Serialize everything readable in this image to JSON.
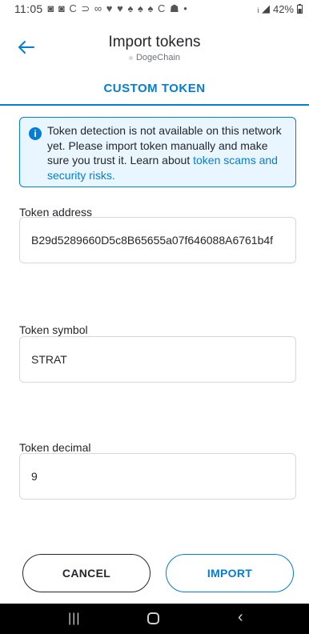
{
  "status_bar": {
    "time": "11:05",
    "icons": "◙ ◙ C ⊃ ∞ ♥ ♥ ♠ ♠ ♠ C ☗ •",
    "signal": "ᵢ ◢",
    "battery": "42%"
  },
  "header": {
    "title": "Import tokens",
    "network": "DogeChain"
  },
  "tab": {
    "label": "CUSTOM TOKEN"
  },
  "alert": {
    "icon": "i",
    "text": "Token detection is not available on this network yet. Please import token manually and make sure you trust it. Learn about ",
    "link": "token scams and security risks."
  },
  "form": {
    "address": {
      "label": "Token address",
      "value": "B29d5289660D5c8B65655a07f646088A6761b4f"
    },
    "symbol": {
      "label": "Token symbol",
      "value": "STRAT"
    },
    "decimal": {
      "label": "Token decimal",
      "value": "9"
    }
  },
  "buttons": {
    "cancel": "CANCEL",
    "import": "IMPORT"
  },
  "colors": {
    "primary": "#037dd6",
    "text": "#24272a",
    "alert_bg": "#eaf6ff",
    "border": "#d6d9dc"
  },
  "nav": {
    "recent": "|||",
    "back": "‹"
  }
}
